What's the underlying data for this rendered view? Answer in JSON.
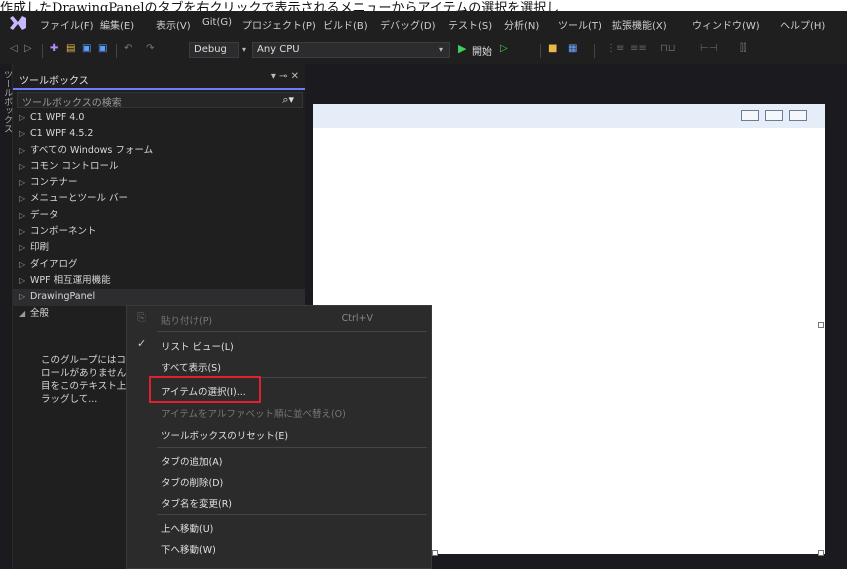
{
  "caption": "作成したDrawingPanelのタブを右クリックで表示されるメニューからアイテムの選択を選択し",
  "menubar": {
    "items": [
      "ファイル(F)",
      "編集(E)",
      "表示(V)",
      "Git(G)",
      "プロジェクト(P)",
      "ビルド(B)",
      "デバッグ(D)",
      "テスト(S)",
      "分析(N)",
      "ツール(T)",
      "拡張機能(X)",
      "ウィンドウ(W)",
      "ヘルプ(H)"
    ]
  },
  "toolbar": {
    "config": "Debug",
    "platform": "Any CPU",
    "start_label": "開始"
  },
  "side_tab": "ツールボックス",
  "toolbox": {
    "title": "ツールボックス",
    "controls": "▾ ⊸ ✕",
    "search_placeholder": "ツールボックスの検索",
    "items": [
      {
        "arrow": "▷",
        "label": "C1 WPF 4.0"
      },
      {
        "arrow": "▷",
        "label": "C1 WPF 4.5.2"
      },
      {
        "arrow": "▷",
        "label": "すべての Windows フォーム"
      },
      {
        "arrow": "▷",
        "label": "コモン コントロール"
      },
      {
        "arrow": "▷",
        "label": "コンテナー"
      },
      {
        "arrow": "▷",
        "label": "メニューとツール バー"
      },
      {
        "arrow": "▷",
        "label": "データ"
      },
      {
        "arrow": "▷",
        "label": "コンポーネント"
      },
      {
        "arrow": "▷",
        "label": "印刷"
      },
      {
        "arrow": "▷",
        "label": "ダイアログ"
      },
      {
        "arrow": "▷",
        "label": "WPF 相互運用機能"
      },
      {
        "arrow": "▷",
        "label": "DrawingPanel"
      },
      {
        "arrow": "◢",
        "label": "全般"
      }
    ],
    "empty_message": "このグループにはコントロールがありません。項目をこのテキスト上にドラッグして..."
  },
  "context_menu": {
    "items": [
      {
        "icon": "⎘",
        "label": "貼り付け(P)",
        "shortcut": "Ctrl+V",
        "disabled": true
      },
      {
        "icon": "✓",
        "label": "リスト ビュー(L)",
        "shortcut": "",
        "disabled": false
      },
      {
        "icon": "",
        "label": "すべて表示(S)",
        "shortcut": "",
        "disabled": false
      },
      {
        "icon": "",
        "label": "アイテムの選択(I)...",
        "shortcut": "",
        "disabled": false
      },
      {
        "icon": "",
        "label": "アイテムをアルファベット順に並べ替え(O)",
        "shortcut": "",
        "disabled": true
      },
      {
        "icon": "",
        "label": "ツールボックスのリセット(E)",
        "shortcut": "",
        "disabled": false
      },
      {
        "icon": "",
        "label": "タブの追加(A)",
        "shortcut": "",
        "disabled": false
      },
      {
        "icon": "",
        "label": "タブの削除(D)",
        "shortcut": "",
        "disabled": false
      },
      {
        "icon": "",
        "label": "タブ名を変更(R)",
        "shortcut": "",
        "disabled": false
      },
      {
        "icon": "",
        "label": "上へ移動(U)",
        "shortcut": "",
        "disabled": false
      },
      {
        "icon": "",
        "label": "下へ移動(W)",
        "shortcut": "",
        "disabled": false
      }
    ]
  },
  "colors": {
    "background": "#1f1f1f",
    "accent": "#6b7cff",
    "highlight_box": "#e02030",
    "form_title": "#e5eef8"
  }
}
